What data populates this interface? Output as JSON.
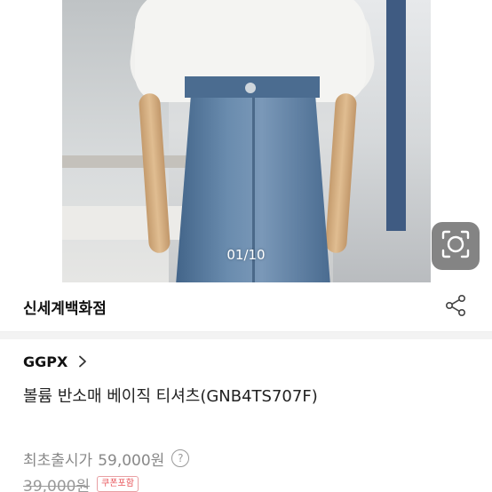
{
  "gallery": {
    "counter": "01/10",
    "lens_button_icon": "camera-lens-icon"
  },
  "store": {
    "name": "신세계백화점",
    "share_icon": "share-icon"
  },
  "product": {
    "brand": "GGPX",
    "brand_chevron_icon": "chevron-right-icon",
    "title": "볼륨 반소매 베이직 티셔츠(GNB4TS707F)",
    "price_label": "최초출시가",
    "price_value": "59,000원",
    "price_info_icon": "question-circle-icon",
    "old_price": "39,000원",
    "coupon_badge": "쿠폰포함"
  },
  "colors": {
    "coupon_red": "#e8565b",
    "text_primary": "#111111",
    "text_muted": "#888888"
  }
}
